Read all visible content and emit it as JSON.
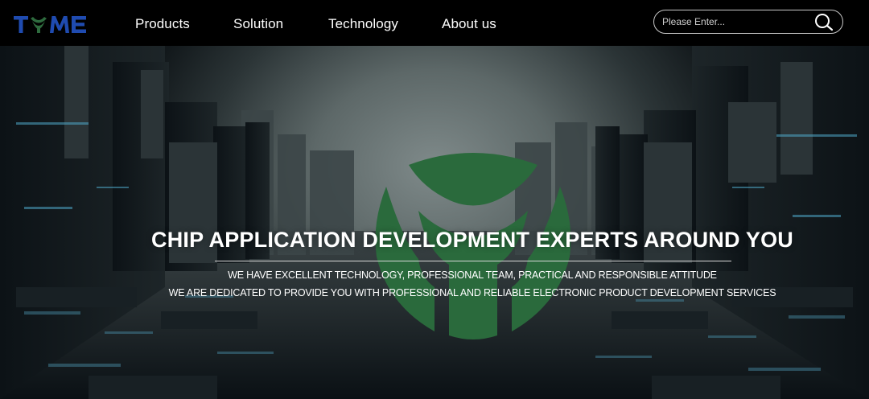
{
  "brand": {
    "logo_text": "TYME",
    "logo_color": "#1f4bb0",
    "logo_accent": "#2e6b3e"
  },
  "nav": {
    "items": [
      {
        "label": "Products"
      },
      {
        "label": "Solution"
      },
      {
        "label": "Technology"
      },
      {
        "label": "About us"
      }
    ]
  },
  "search": {
    "placeholder": "Please Enter...",
    "icon": "search-icon"
  },
  "hero": {
    "headline": "CHIP APPLICATION DEVELOPMENT EXPERTS AROUND YOU",
    "subline_1": "WE HAVE EXCELLENT TECHNOLOGY, PROFESSIONAL TEAM, PRACTICAL AND RESPONSIBLE ATTITUDE",
    "subline_2": "WE ARE DEDICATED TO PROVIDE YOU WITH PROFESSIONAL AND RELIABLE ELECTRONIC PRODUCT DEVELOPMENT SERVICES",
    "emblem_color": "#2a6a3c"
  }
}
